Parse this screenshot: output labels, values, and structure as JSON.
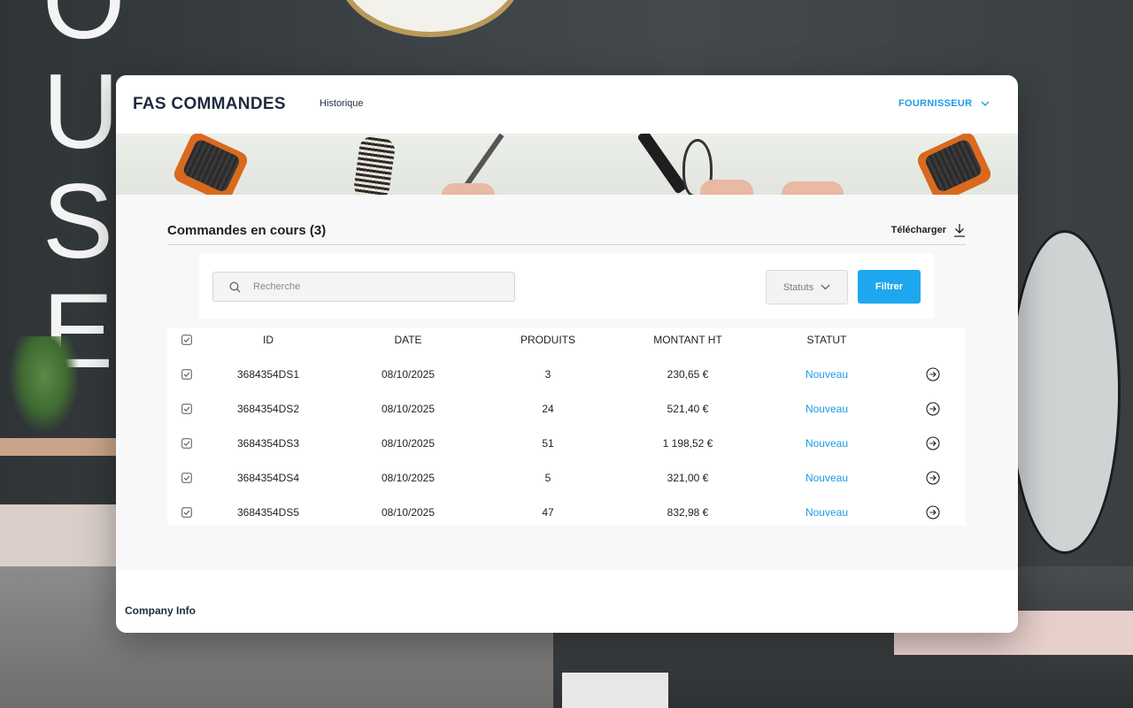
{
  "app": {
    "brand": "FAS COMMANDES",
    "nav_history": "Historique",
    "supplier_menu": "FOURNISSEUR"
  },
  "section": {
    "title": "Commandes en cours (3)",
    "download_label": "Télécharger"
  },
  "filters": {
    "search_placeholder": "Recherche",
    "status_label": "Statuts",
    "filter_button": "Filtrer"
  },
  "table": {
    "headers": {
      "id": "ID",
      "date": "DATE",
      "products": "PRODUITS",
      "amount": "MONTANT HT",
      "status": "STATUT"
    },
    "rows": [
      {
        "id": "3684354DS1",
        "date": "08/10/2025",
        "products": "3",
        "amount": "230,65 €",
        "status": "Nouveau"
      },
      {
        "id": "3684354DS2",
        "date": "08/10/2025",
        "products": "24",
        "amount": "521,40 €",
        "status": "Nouveau"
      },
      {
        "id": "3684354DS3",
        "date": "08/10/2025",
        "products": "51",
        "amount": "1 198,52 €",
        "status": "Nouveau"
      },
      {
        "id": "3684354DS4",
        "date": "08/10/2025",
        "products": "5",
        "amount": "321,00 €",
        "status": "Nouveau"
      },
      {
        "id": "3684354DS5",
        "date": "08/10/2025",
        "products": "47",
        "amount": "832,98 €",
        "status": "Nouveau"
      }
    ]
  },
  "footer": {
    "label": "Company Info"
  },
  "colors": {
    "accent": "#1ea7ee",
    "status_link": "#1e9be4",
    "brand_text": "#1f2b3d"
  }
}
